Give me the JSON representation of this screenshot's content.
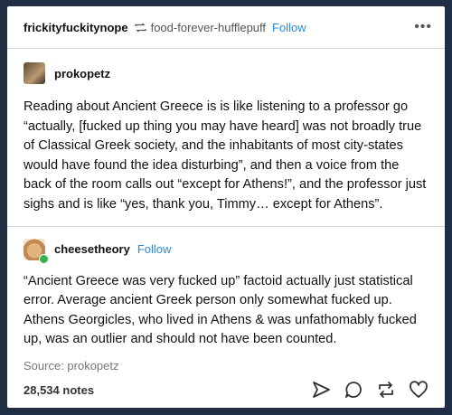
{
  "header": {
    "reblogger": "frickityfuckitynope",
    "source_blog": "food-forever-hufflepuff",
    "follow_label": "Follow",
    "more_label": "•••"
  },
  "post1": {
    "author": "prokopetz",
    "text": "Reading about Ancient Greece is is like listening to a professor go “actually, [fucked up thing you may have heard] was not broadly true of Classical Greek society, and the inhabitants of most city-states would have found the idea disturbing”, and then a voice from the back of the room calls out “except for Athens!”, and the professor just sighs and is like “yes, thank you, Timmy… except for Athens”."
  },
  "post2": {
    "author": "cheesetheory",
    "follow_label": "Follow",
    "text": "“Ancient Greece was very fucked up” factoid actually just statistical error. Average ancient Greek person only somewhat fucked up. Athens Georgicles, who lived in Athens & was unfathomably fucked up, was an outlier and should not have been counted."
  },
  "source_text": "Source: prokopetz",
  "footer": {
    "notes": "28,534 notes",
    "icons": [
      "share-icon",
      "reply-icon",
      "reblog-icon",
      "like-icon"
    ]
  },
  "colors": {
    "background": "#1f2e45",
    "follow": "#2b8bd6",
    "text": "#111111"
  }
}
